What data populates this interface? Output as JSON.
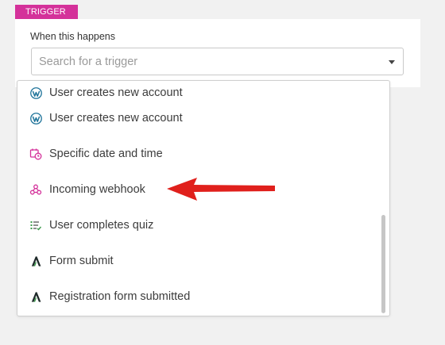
{
  "trigger": {
    "tag_label": "TRIGGER",
    "when_label": "When this happens",
    "search_placeholder": "Search for a trigger"
  },
  "dropdown": {
    "items": [
      {
        "label": "User creates new account",
        "icon": "wordpress-icon"
      },
      {
        "label": "User creates new account",
        "icon": "wordpress-icon"
      },
      {
        "label": "Specific date and time",
        "icon": "calendar-clock-icon"
      },
      {
        "label": "Incoming webhook",
        "icon": "webhook-icon"
      },
      {
        "label": "User completes quiz",
        "icon": "quiz-list-icon"
      },
      {
        "label": "Form submit",
        "icon": "forms-logo-icon"
      },
      {
        "label": "Registration form submitted",
        "icon": "forms-logo-icon"
      }
    ]
  },
  "colors": {
    "accent": "#d4319a",
    "annotation_arrow": "#e0201c",
    "wordpress": "#21759b",
    "quiz": "#3f9b4e",
    "forms_logo": "#1f2a2a"
  }
}
